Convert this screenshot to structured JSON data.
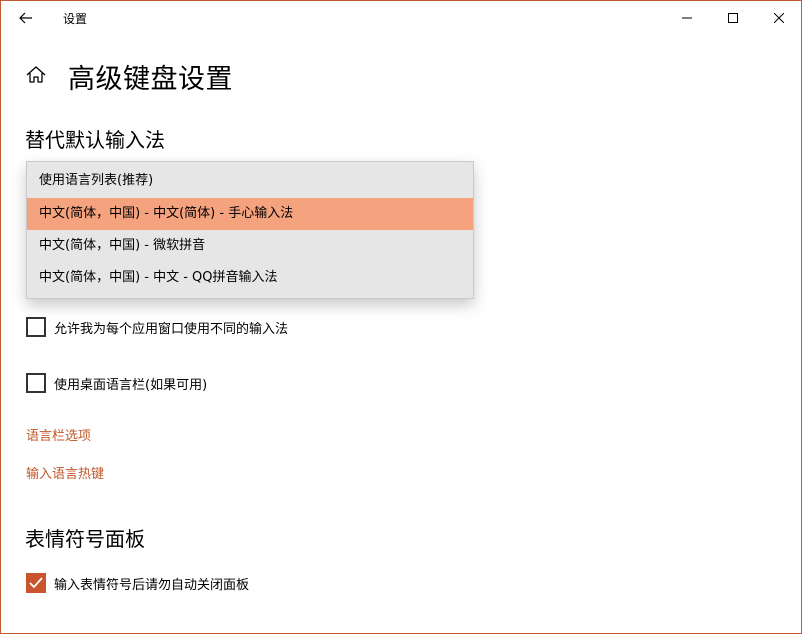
{
  "window": {
    "title": "设置",
    "accent_color": "#c8552c",
    "controls": [
      "minimize",
      "maximize",
      "close"
    ]
  },
  "header": {
    "page_title": "高级键盘设置"
  },
  "sections": {
    "input_method": {
      "title": "替代默认输入法",
      "dropdown": {
        "options": [
          "使用语言列表(推荐)",
          "中文(简体，中国) - 中文(简体) - 手心输入法",
          "中文(简体，中国) - 微软拼音",
          "中文(简体，中国) - 中文 - QQ拼音输入法"
        ],
        "selected_index": 1,
        "highlight_color": "#f5a27f"
      },
      "checkbox_per_app": {
        "label": "允许我为每个应用窗口使用不同的输入法",
        "checked": false
      },
      "checkbox_desktop_bar": {
        "label": "使用桌面语言栏(如果可用)",
        "checked": false
      },
      "link_bar_options": "语言栏选项",
      "link_hotkeys": "输入语言热键"
    },
    "emoji_panel": {
      "title": "表情符号面板",
      "checkbox_auto_close": {
        "label": "输入表情符号后请勿自动关闭面板",
        "checked": true
      }
    }
  },
  "link_color": "#c0582b"
}
